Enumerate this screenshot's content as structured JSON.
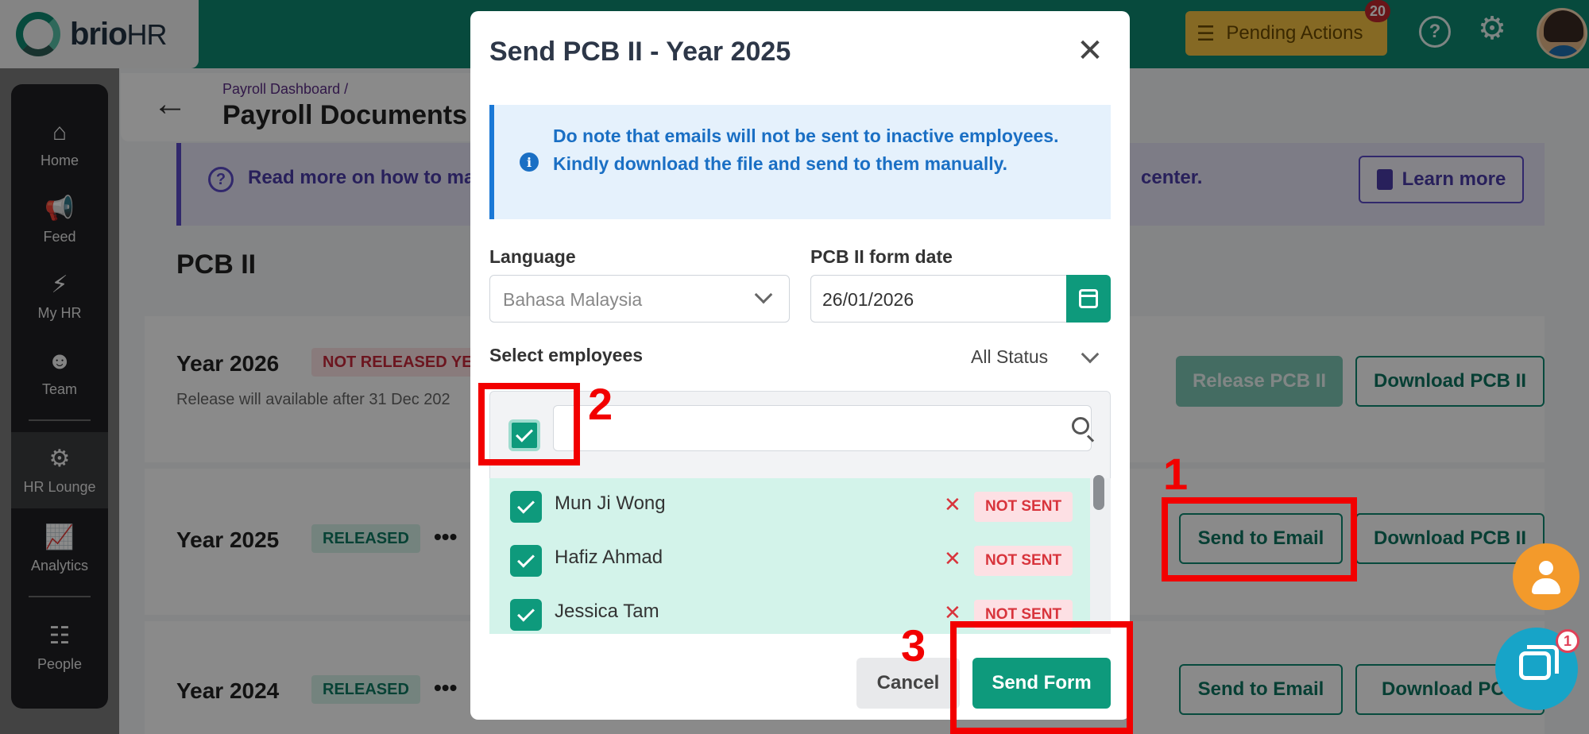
{
  "app": {
    "logo_text": "brio",
    "logo_text_suffix": "HR",
    "pending_label": "Pending Actions",
    "pending_count": "20"
  },
  "sidebar": {
    "items": [
      {
        "label": "Home",
        "icon": "home-icon"
      },
      {
        "label": "Feed",
        "icon": "megaphone-icon"
      },
      {
        "label": "My HR",
        "icon": "lightning-icon"
      },
      {
        "label": "Team",
        "icon": "team-icon"
      },
      {
        "label": "HR Lounge",
        "icon": "user-gear-icon"
      },
      {
        "label": "Analytics",
        "icon": "chart-icon"
      },
      {
        "label": "People",
        "icon": "org-chart-icon"
      }
    ]
  },
  "breadcrumb": {
    "parent": "Payroll Dashboard",
    "separator": "/",
    "title": "Payroll Documents"
  },
  "banner": {
    "text": "Read more on how to mar",
    "text_tail": "center.",
    "learn_more": "Learn more"
  },
  "section": {
    "title": "PCB II",
    "rows": [
      {
        "year": "Year 2026",
        "status": "NOT RELEASED YET",
        "note": "Release will available after 31 Dec 202",
        "primary": "Release PCB II",
        "secondary": "Download PCB II"
      },
      {
        "year": "Year 2025",
        "status": "RELEASED",
        "menu": "•••",
        "primary": "Send to Email",
        "secondary": "Download PCB II"
      },
      {
        "year": "Year 2024",
        "status": "RELEASED",
        "menu": "•••",
        "primary": "Send to Email",
        "secondary": "Download PCB"
      }
    ]
  },
  "modal": {
    "title": "Send PCB II - Year 2025",
    "close_icon": "✕",
    "alert": "Do note that emails will not be sent to inactive employees. Kindly download the file and send to them manually.",
    "language_label": "Language",
    "language_value": "Bahasa Malaysia",
    "date_label": "PCB II form date",
    "date_value": "26/01/2026",
    "select_label": "Select employees",
    "status_filter": "All Status",
    "search_placeholder": "",
    "employees": [
      {
        "name": "Mun Ji Wong",
        "status": "NOT SENT",
        "checked": true
      },
      {
        "name": "Hafiz Ahmad",
        "status": "NOT SENT",
        "checked": true
      },
      {
        "name": "Jessica Tam",
        "status": "NOT SENT",
        "checked": true
      }
    ],
    "cancel": "Cancel",
    "send": "Send Form"
  },
  "annotations": {
    "n1": "1",
    "n2": "2",
    "n3": "3",
    "color": "#f20000"
  },
  "chat_badge": "1",
  "colors": {
    "brand_green": "#0e8a72",
    "primary_button": "#0e9a7c",
    "alert_blue": "#1a6fc4",
    "danger": "#d8343c"
  }
}
